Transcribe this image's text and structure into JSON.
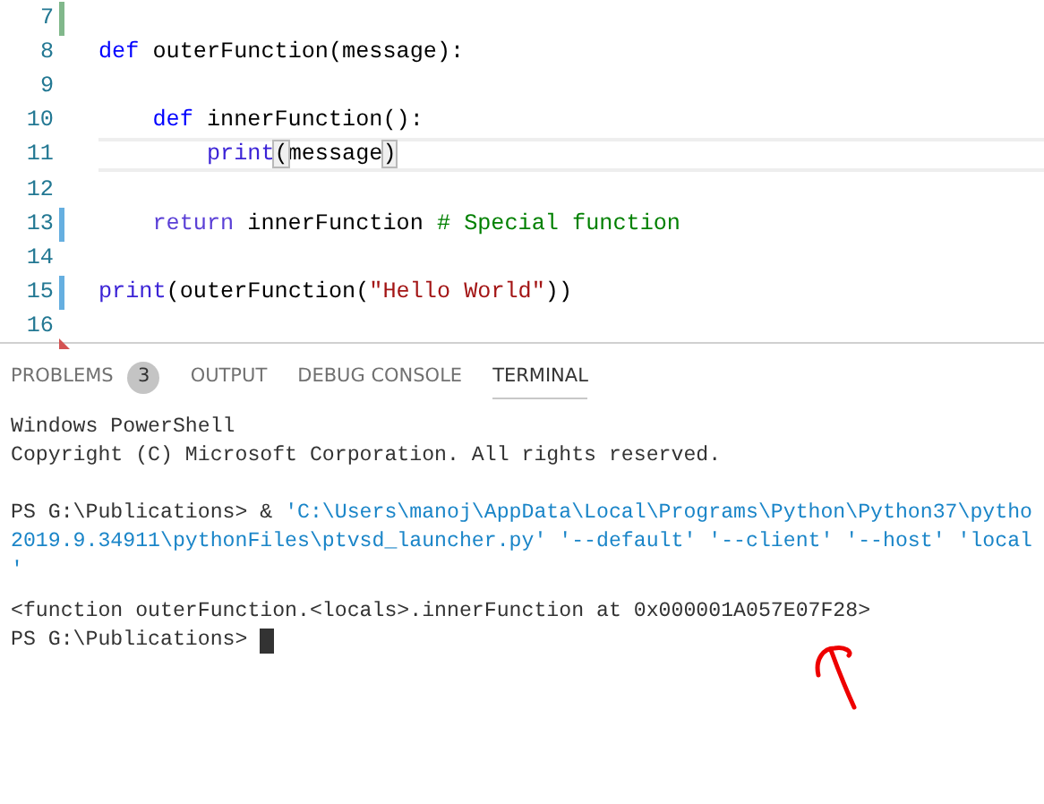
{
  "editor": {
    "lines": [
      {
        "number": "7",
        "color": "#81b88b",
        "current": false
      },
      {
        "number": "8",
        "current": false,
        "tokens": [
          {
            "kind": "keyword",
            "text": "def"
          },
          {
            "kind": "plain",
            "text": " outerFunction(message):"
          }
        ]
      },
      {
        "number": "9",
        "current": false
      },
      {
        "number": "10",
        "current": false,
        "tokens": [
          {
            "kind": "keyword",
            "text": "    def"
          },
          {
            "kind": "plain",
            "text": " innerFunction():"
          }
        ]
      },
      {
        "number": "11",
        "current": true,
        "tokens": [
          {
            "kind": "builtin",
            "text": "        print"
          },
          {
            "kind": "bracket",
            "text": "("
          },
          {
            "kind": "plain",
            "text": "message"
          },
          {
            "kind": "bracket",
            "text": ")"
          }
        ]
      },
      {
        "number": "12",
        "current": false
      },
      {
        "number": "13",
        "color": "#66afe0",
        "current": false,
        "tokens": [
          {
            "kind": "control",
            "text": "    return"
          },
          {
            "kind": "plain",
            "text": " innerFunction "
          },
          {
            "kind": "comment",
            "text": "# Special function"
          }
        ]
      },
      {
        "number": "14",
        "current": false
      },
      {
        "number": "15",
        "color": "#66afe0",
        "current": false,
        "tokens": [
          {
            "kind": "builtin",
            "text": "print"
          },
          {
            "kind": "plain",
            "text": "(outerFunction("
          },
          {
            "kind": "string",
            "text": "\"Hello World\""
          },
          {
            "kind": "plain",
            "text": "))"
          }
        ]
      },
      {
        "number": "16",
        "color": "#d35252",
        "current": false
      }
    ]
  },
  "panel": {
    "tabs": [
      {
        "label": "PROBLEMS",
        "badge": "3",
        "selected": false
      },
      {
        "label": "OUTPUT",
        "selected": false
      },
      {
        "label": "DEBUG CONSOLE",
        "selected": false
      },
      {
        "label": "TERMINAL",
        "selected": true
      }
    ],
    "terminal": {
      "blocks": [
        [
          [
            {
              "kind": "plain",
              "text": "Windows PowerShell"
            }
          ],
          [
            {
              "kind": "plain",
              "text": "Copyright (C) Microsoft Corporation. All rights reserved."
            }
          ]
        ],
        [
          [
            {
              "kind": "plain",
              "text": "PS G:\\Publications> & "
            },
            {
              "kind": "path",
              "text": "'C:\\Users\\manoj\\AppData\\Local\\Programs\\Python\\Python37\\pytho"
            }
          ],
          [
            {
              "kind": "path",
              "text": "2019.9.34911\\pythonFiles\\ptvsd_launcher.py' '--default' '--client' '--host' 'local"
            }
          ],
          [
            {
              "kind": "path",
              "text": "'"
            }
          ]
        ],
        [
          [
            {
              "kind": "plain",
              "text": "<function outerFunction.<locals>.innerFunction at 0x000001A057E07F28>"
            }
          ],
          [
            {
              "kind": "plain",
              "text": "PS G:\\Publications> "
            },
            {
              "kind": "cursor"
            }
          ]
        ]
      ]
    }
  }
}
